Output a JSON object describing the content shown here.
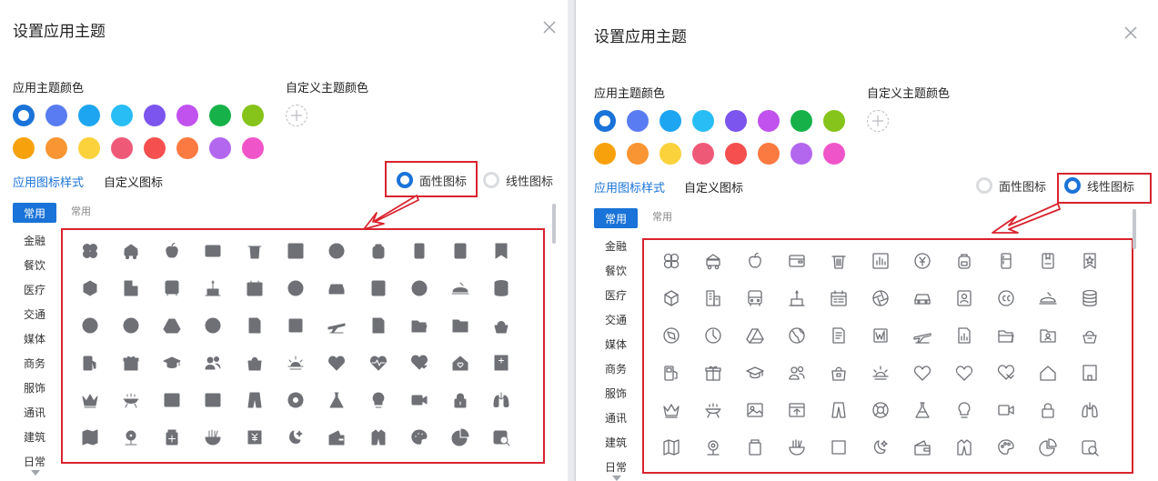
{
  "dialog": {
    "title": "设置应用主题"
  },
  "theme_colors": {
    "label": "应用主题颜色",
    "custom_label": "自定义主题颜色",
    "swatches": [
      "#1a73d8",
      "#5a7cf2",
      "#1ea5f1",
      "#28bdf5",
      "#7b55ee",
      "#c152ee",
      "#16b249",
      "#86c41b",
      "#f7a20d",
      "#f99532",
      "#fbd23c",
      "#ef5978",
      "#f64f4f",
      "#fb7a41",
      "#b367ee",
      "#ef55c9"
    ],
    "selected_index": 0
  },
  "icon_style": {
    "tab_label": "应用图标样式",
    "custom_tab_label": "自定义图标",
    "filled_label": "面性图标",
    "outline_label": "线性图标"
  },
  "categories": {
    "active_label": "常用",
    "header_label": "常用",
    "items": [
      "金融",
      "餐饮",
      "医疗",
      "交通",
      "媒体",
      "商务",
      "服饰",
      "通讯",
      "建筑",
      "日常"
    ]
  },
  "icons": {
    "rows": [
      [
        "clover-icon",
        "bus-icon",
        "apple-icon",
        "wallet-icon",
        "trash-icon",
        "bar-chart-icon",
        "yen-coin-icon",
        "backpack-icon",
        "fridge-icon",
        "bookmark-card-icon",
        "star-bookmark-icon"
      ],
      [
        "cube-icon",
        "building-icon",
        "bus-front-icon",
        "cake-icon",
        "calendar-icon",
        "aperture-icon",
        "car-icon",
        "contact-card-icon",
        "cc-icon",
        "dish-icon",
        "database-icon"
      ],
      [
        "compass-icon",
        "clock-pie-icon",
        "drive-icon",
        "globe-icon",
        "document-icon",
        "word-icon",
        "airplane-icon",
        "report-chart-icon",
        "folder-open-icon",
        "folder-user-icon",
        "basket-icon"
      ],
      [
        "fuel-icon",
        "gift-icon",
        "graduation-cap-icon",
        "users-icon",
        "lock-bag-icon",
        "sunrise-icon",
        "heart-icon",
        "heart-pulse-icon",
        "heart-hand-icon",
        "home-heart-icon",
        "hospital-icon"
      ],
      [
        "crown-icon",
        "grill-icon",
        "image-icon",
        "inbox-upload-icon",
        "trousers-icon",
        "lifebuoy-icon",
        "flask-icon",
        "lightbulb-icon",
        "video-icon",
        "padlock-icon",
        "lungs-icon"
      ],
      [
        "map-icon",
        "location-pin-icon",
        "medicine-icon",
        "noodles-icon",
        "yen-note-icon",
        "moon-star-icon",
        "wallet-open-icon",
        "coat-icon",
        "palette-icon",
        "pie-chart-icon",
        "magnify-card-icon"
      ]
    ]
  },
  "colors": {
    "accent": "#1a73d8",
    "highlight": "#d9232e",
    "icon_fill": "#6e7076",
    "icon_line": "#6e7076"
  }
}
